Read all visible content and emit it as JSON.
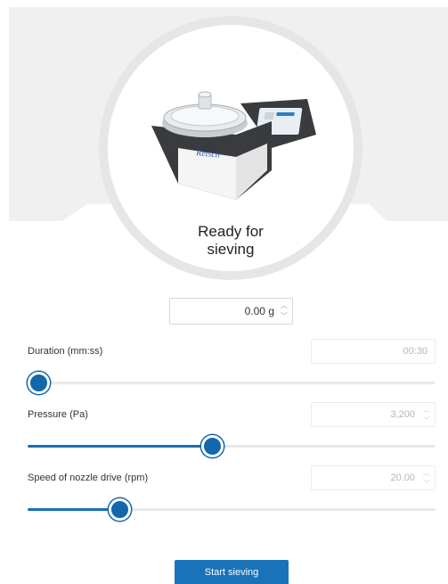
{
  "status": {
    "line1": "Ready for",
    "line2": "sieving"
  },
  "device": {
    "brand": "Retsch"
  },
  "weight": {
    "value": "0.00 g"
  },
  "params": [
    {
      "label": "Duration (mm:ss)",
      "value": "00:30",
      "fraction": 0.0
    },
    {
      "label": "Pressure (Pa)",
      "value": "3,200",
      "fraction": 0.45
    },
    {
      "label": "Speed of nozzle drive (rpm)",
      "value": "20.00",
      "fraction": 0.21
    }
  ],
  "actions": {
    "start_label": "Start sieving"
  },
  "colors": {
    "accent": "#1a73b8",
    "banner": "#f0f0f1"
  }
}
